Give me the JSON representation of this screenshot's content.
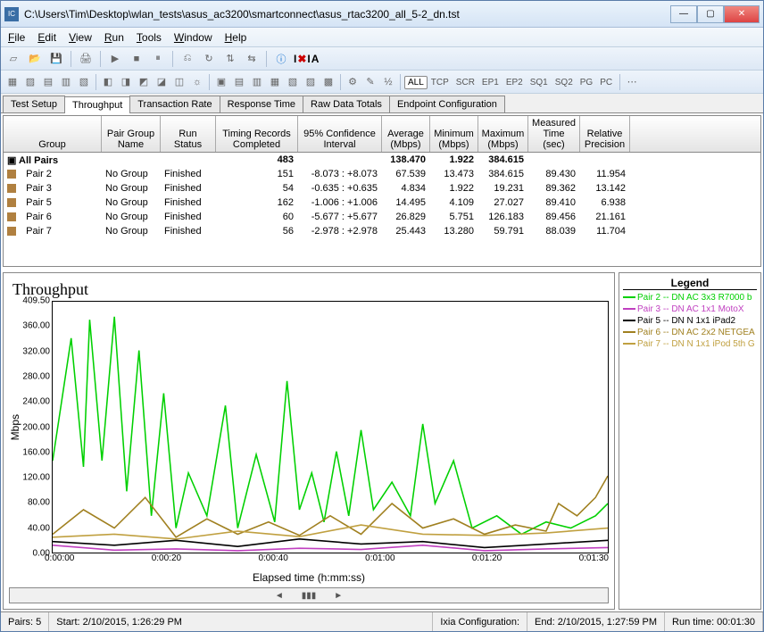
{
  "title": "C:\\Users\\Tim\\Desktop\\wlan_tests\\asus_ac3200\\smartconnect\\asus_rtac3200_all_5-2_dn.tst",
  "menu": {
    "file": "File",
    "edit": "Edit",
    "view": "View",
    "run": "Run",
    "tools": "Tools",
    "window": "Window",
    "help": "Help"
  },
  "toolbar2_filters": [
    "ALL",
    "TCP",
    "SCR",
    "EP1",
    "EP2",
    "SQ1",
    "SQ2",
    "PG",
    "PC"
  ],
  "tabs": [
    "Test Setup",
    "Throughput",
    "Transaction Rate",
    "Response Time",
    "Raw Data Totals",
    "Endpoint Configuration"
  ],
  "active_tab": 1,
  "columns": [
    "Group",
    "Pair Group Name",
    "Run Status",
    "Timing Records Completed",
    "95% Confidence Interval",
    "Average (Mbps)",
    "Minimum (Mbps)",
    "Maximum (Mbps)",
    "Measured Time (sec)",
    "Relative Precision"
  ],
  "summary": {
    "label": "All Pairs",
    "timing": "483",
    "avg": "138.470",
    "min": "1.922",
    "max": "384.615"
  },
  "rows": [
    {
      "pair": "Pair 2",
      "pg": "No Group",
      "rs": "Finished",
      "tr": "151",
      "ci": "-8.073 : +8.073",
      "av": "67.539",
      "mn": "13.473",
      "mx": "384.615",
      "mt": "89.430",
      "rp": "11.954"
    },
    {
      "pair": "Pair 3",
      "pg": "No Group",
      "rs": "Finished",
      "tr": "54",
      "ci": "-0.635 : +0.635",
      "av": "4.834",
      "mn": "1.922",
      "mx": "19.231",
      "mt": "89.362",
      "rp": "13.142"
    },
    {
      "pair": "Pair 5",
      "pg": "No Group",
      "rs": "Finished",
      "tr": "162",
      "ci": "-1.006 : +1.006",
      "av": "14.495",
      "mn": "4.109",
      "mx": "27.027",
      "mt": "89.410",
      "rp": "6.938"
    },
    {
      "pair": "Pair 6",
      "pg": "No Group",
      "rs": "Finished",
      "tr": "60",
      "ci": "-5.677 : +5.677",
      "av": "26.829",
      "mn": "5.751",
      "mx": "126.183",
      "mt": "89.456",
      "rp": "21.161"
    },
    {
      "pair": "Pair 7",
      "pg": "No Group",
      "rs": "Finished",
      "tr": "56",
      "ci": "-2.978 : +2.978",
      "av": "25.443",
      "mn": "13.280",
      "mx": "59.791",
      "mt": "88.039",
      "rp": "11.704"
    }
  ],
  "chart": {
    "title": "Throughput",
    "ylabel": "Mbps",
    "xlabel": "Elapsed time (h:mm:ss)",
    "y_ticks": [
      "409.50",
      "360.00",
      "320.00",
      "280.00",
      "240.00",
      "200.00",
      "160.00",
      "120.00",
      "80.00",
      "40.00",
      "0.00"
    ],
    "x_ticks": [
      "0:00:00",
      "0:00:20",
      "0:00:40",
      "0:01:00",
      "0:01:20",
      "0:01:30"
    ]
  },
  "chart_data": {
    "type": "line",
    "ylim": [
      0,
      409.5
    ],
    "x_seconds": [
      0,
      20,
      40,
      60,
      80,
      90
    ],
    "series": [
      {
        "name": "Pair 2 -- DN  AC 3x3 R7000 b",
        "color": "#00d000",
        "x": [
          0,
          3,
          5,
          6,
          8,
          10,
          12,
          14,
          16,
          18,
          20,
          22,
          25,
          28,
          30,
          33,
          36,
          38,
          40,
          42,
          44,
          46,
          48,
          50,
          52,
          55,
          58,
          60,
          62,
          65,
          68,
          72,
          76,
          80,
          84,
          88,
          90
        ],
        "y": [
          150,
          350,
          140,
          380,
          150,
          385,
          100,
          330,
          60,
          260,
          40,
          130,
          60,
          240,
          40,
          160,
          50,
          280,
          70,
          130,
          50,
          165,
          60,
          200,
          70,
          115,
          60,
          210,
          80,
          150,
          40,
          60,
          30,
          50,
          40,
          60,
          80
        ]
      },
      {
        "name": "Pair 3 -- DN AC 1x1 MotoX",
        "color": "#c040c0",
        "x": [
          0,
          10,
          20,
          30,
          40,
          50,
          60,
          70,
          80,
          90
        ],
        "y": [
          12,
          4,
          6,
          3,
          7,
          5,
          12,
          3,
          6,
          8
        ]
      },
      {
        "name": "Pair 5 -- DN N 1x1 iPad2",
        "color": "#000000",
        "x": [
          0,
          10,
          20,
          30,
          40,
          50,
          60,
          70,
          80,
          90
        ],
        "y": [
          18,
          12,
          20,
          10,
          22,
          14,
          18,
          8,
          14,
          20
        ]
      },
      {
        "name": "Pair 6 -- DN  AC 2x2 NETGEA",
        "color": "#a08020",
        "x": [
          0,
          5,
          10,
          15,
          20,
          25,
          30,
          35,
          40,
          45,
          50,
          55,
          60,
          65,
          70,
          75,
          80,
          82,
          85,
          88,
          90
        ],
        "y": [
          30,
          70,
          40,
          90,
          25,
          55,
          30,
          50,
          28,
          60,
          30,
          80,
          40,
          55,
          30,
          45,
          35,
          80,
          60,
          90,
          125
        ]
      },
      {
        "name": "Pair 7 -- DN  N 1x1 iPod 5th G",
        "color": "#c0a040",
        "x": [
          0,
          10,
          20,
          30,
          40,
          50,
          60,
          70,
          80,
          90
        ],
        "y": [
          25,
          30,
          22,
          35,
          26,
          45,
          30,
          28,
          32,
          40
        ]
      }
    ]
  },
  "legend_title": "Legend",
  "status": {
    "pairs": "Pairs: 5",
    "start": "Start: 2/10/2015, 1:26:29 PM",
    "ixia": "Ixia Configuration:",
    "end": "End: 2/10/2015, 1:27:59 PM",
    "runtime": "Run time: 00:01:30"
  }
}
